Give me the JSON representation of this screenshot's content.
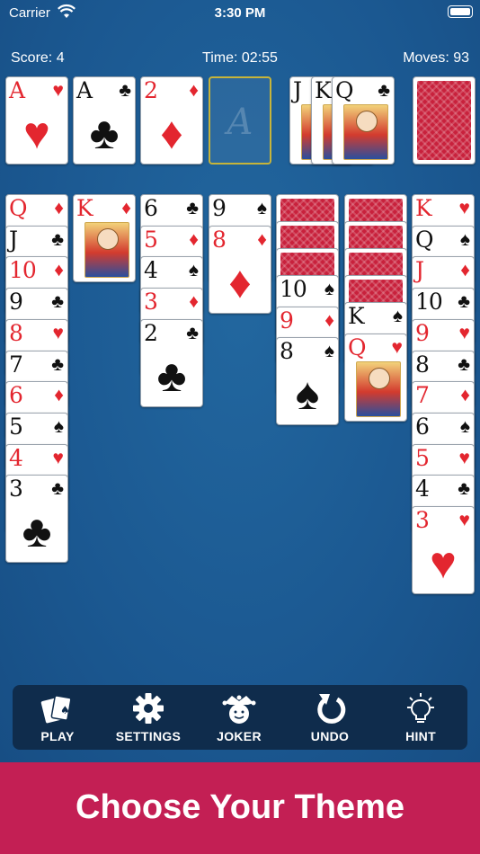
{
  "status": {
    "carrier": "Carrier",
    "clock": "3:30 PM"
  },
  "stats": {
    "score": "Score: 4",
    "time": "Time: 02:55",
    "moves": "Moves: 93"
  },
  "foundations": [
    {
      "rank": "A",
      "suit": "♥",
      "color": "red"
    },
    {
      "rank": "A",
      "suit": "♣",
      "color": "black"
    },
    {
      "rank": "2",
      "suit": "♦",
      "color": "red"
    },
    {
      "rank": "A",
      "suit": "",
      "color": "empty"
    }
  ],
  "waste": [
    {
      "rank": "J",
      "suit": "",
      "color": "black"
    },
    {
      "rank": "K",
      "suit": "",
      "color": "black"
    },
    {
      "rank": "Q",
      "suit": "♣",
      "color": "black"
    }
  ],
  "tableau": [
    {
      "hidden": 0,
      "cards": [
        {
          "rank": "Q",
          "suit": "♦",
          "color": "red"
        },
        {
          "rank": "J",
          "suit": "♣",
          "color": "black"
        },
        {
          "rank": "10",
          "suit": "♦",
          "color": "red"
        },
        {
          "rank": "9",
          "suit": "♣",
          "color": "black"
        },
        {
          "rank": "8",
          "suit": "♥",
          "color": "red"
        },
        {
          "rank": "7",
          "suit": "♣",
          "color": "black"
        },
        {
          "rank": "6",
          "suit": "♦",
          "color": "red"
        },
        {
          "rank": "5",
          "suit": "♠",
          "color": "black"
        },
        {
          "rank": "4",
          "suit": "♥",
          "color": "red"
        },
        {
          "rank": "3",
          "suit": "♣",
          "color": "black"
        }
      ]
    },
    {
      "hidden": 0,
      "cards": [
        {
          "rank": "K",
          "suit": "♦",
          "color": "red"
        }
      ]
    },
    {
      "hidden": 0,
      "cards": [
        {
          "rank": "6",
          "suit": "♣",
          "color": "black"
        },
        {
          "rank": "5",
          "suit": "♦",
          "color": "red"
        },
        {
          "rank": "4",
          "suit": "♠",
          "color": "black"
        },
        {
          "rank": "3",
          "suit": "♦",
          "color": "red"
        },
        {
          "rank": "2",
          "suit": "♣",
          "color": "black"
        }
      ]
    },
    {
      "hidden": 0,
      "cards": [
        {
          "rank": "9",
          "suit": "♠",
          "color": "black"
        },
        {
          "rank": "8",
          "suit": "♦",
          "color": "red"
        }
      ]
    },
    {
      "hidden": 3,
      "cards": [
        {
          "rank": "10",
          "suit": "♠",
          "color": "black"
        },
        {
          "rank": "9",
          "suit": "♦",
          "color": "red"
        },
        {
          "rank": "8",
          "suit": "♠",
          "color": "black"
        }
      ]
    },
    {
      "hidden": 4,
      "cards": [
        {
          "rank": "K",
          "suit": "♠",
          "color": "black"
        },
        {
          "rank": "Q",
          "suit": "♥",
          "color": "red"
        }
      ]
    },
    {
      "hidden": 0,
      "cards": [
        {
          "rank": "K",
          "suit": "♥",
          "color": "red"
        },
        {
          "rank": "Q",
          "suit": "♠",
          "color": "black"
        },
        {
          "rank": "J",
          "suit": "♦",
          "color": "red"
        },
        {
          "rank": "10",
          "suit": "♣",
          "color": "black"
        },
        {
          "rank": "9",
          "suit": "♥",
          "color": "red"
        },
        {
          "rank": "8",
          "suit": "♣",
          "color": "black"
        },
        {
          "rank": "7",
          "suit": "♦",
          "color": "red"
        },
        {
          "rank": "6",
          "suit": "♠",
          "color": "black"
        },
        {
          "rank": "5",
          "suit": "♥",
          "color": "red"
        },
        {
          "rank": "4",
          "suit": "♣",
          "color": "black"
        },
        {
          "rank": "3",
          "suit": "♥",
          "color": "red"
        }
      ]
    }
  ],
  "toolbar": {
    "play": "PLAY",
    "settings": "SETTINGS",
    "joker": "JOKER",
    "undo": "UNDO",
    "hint": "HINT",
    "icons": [
      "cards-icon",
      "gear-icon",
      "jester-icon",
      "undo-icon",
      "lightbulb-icon"
    ]
  },
  "banner": {
    "text": "Choose Your Theme"
  },
  "colors": {
    "felt": "#1c5a94",
    "toolbar": "#0f2c4c",
    "banner": "#c31f54",
    "red_suit": "#e3262f",
    "card_back": "#c8213c"
  }
}
